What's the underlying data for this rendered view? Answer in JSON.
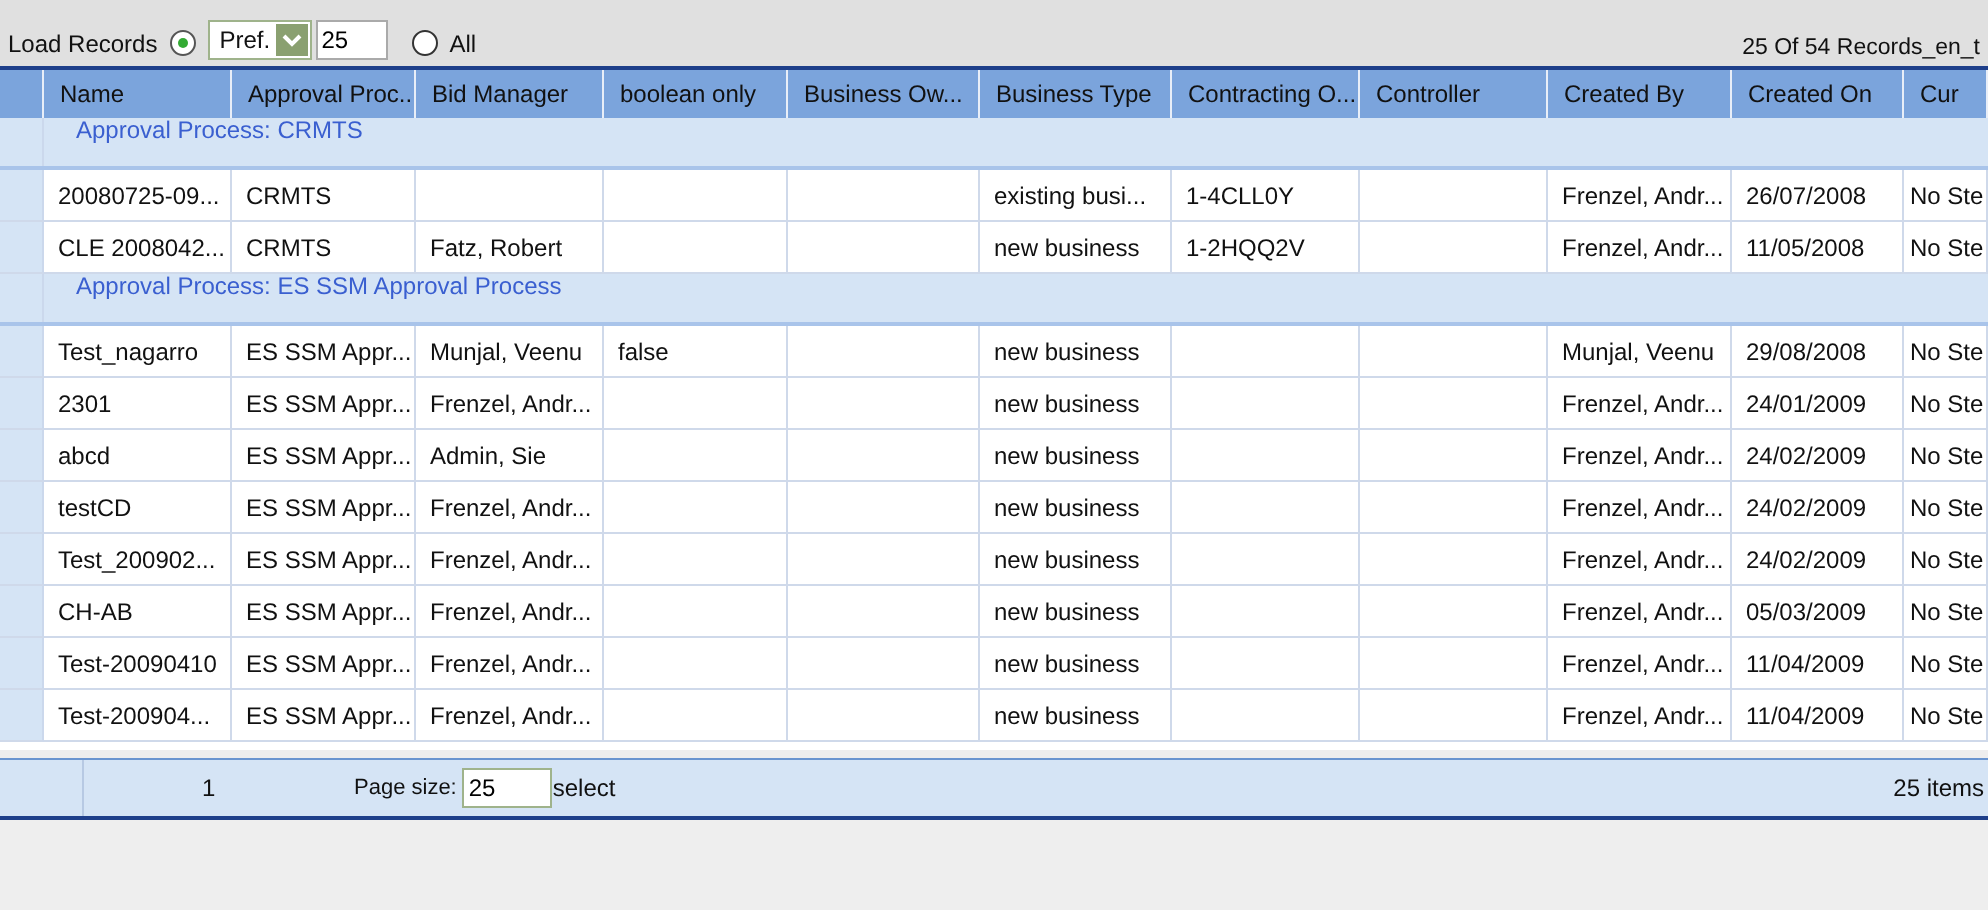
{
  "toolbar": {
    "label": "Load Records",
    "options": [
      {
        "selected": true,
        "kind": "pref"
      },
      {
        "label": "All",
        "selected": false,
        "kind": "all"
      }
    ],
    "pref_dropdown": {
      "value": "Pref."
    },
    "count_field": {
      "value": "25"
    },
    "record_count": "25 Of 54 Records_en_t"
  },
  "table": {
    "columns": [
      "Name",
      "Approval Proc...",
      "Bid Manager",
      "boolean only",
      "Business Ow...",
      "Business Type",
      "Contracting O...",
      "Controller",
      "Created By",
      "Created On",
      "Cur"
    ],
    "rows": [
      {
        "kind": "group",
        "label": "Approval Process: CRMTS"
      },
      {
        "kind": "data",
        "cells": [
          "20080725-09...",
          "CRMTS",
          "",
          "",
          "",
          "existing busi...",
          "1-4CLL0Y",
          "",
          "Frenzel, Andr...",
          "26/07/2008",
          "No Ste"
        ]
      },
      {
        "kind": "data",
        "cells": [
          "CLE 2008042...",
          "CRMTS",
          "Fatz, Robert",
          "",
          "",
          "new business",
          "1-2HQQ2V",
          "",
          "Frenzel, Andr...",
          "11/05/2008",
          "No Ste"
        ]
      },
      {
        "kind": "group",
        "label": "Approval Process: ES SSM Approval Process"
      },
      {
        "kind": "data",
        "cells": [
          "Test_nagarro",
          "ES SSM Appr...",
          "Munjal, Veenu",
          "false",
          "",
          "new business",
          "",
          "",
          "Munjal, Veenu",
          "29/08/2008",
          "No Ste"
        ]
      },
      {
        "kind": "data",
        "cells": [
          "2301",
          "ES SSM Appr...",
          "Frenzel, Andr...",
          "",
          "",
          "new business",
          "",
          "",
          "Frenzel, Andr...",
          "24/01/2009",
          "No Ste"
        ]
      },
      {
        "kind": "data",
        "cells": [
          "abcd",
          "ES SSM Appr...",
          "Admin, Sie",
          "",
          "",
          "new business",
          "",
          "",
          "Frenzel, Andr...",
          "24/02/2009",
          "No Ste"
        ]
      },
      {
        "kind": "data",
        "cells": [
          "testCD",
          "ES SSM Appr...",
          "Frenzel, Andr...",
          "",
          "",
          "new business",
          "",
          "",
          "Frenzel, Andr...",
          "24/02/2009",
          "No Ste"
        ]
      },
      {
        "kind": "data",
        "cells": [
          "Test_200902...",
          "ES SSM Appr...",
          "Frenzel, Andr...",
          "",
          "",
          "new business",
          "",
          "",
          "Frenzel, Andr...",
          "24/02/2009",
          "No Ste"
        ]
      },
      {
        "kind": "data",
        "cells": [
          "CH-AB",
          "ES SSM Appr...",
          "Frenzel, Andr...",
          "",
          "",
          "new business",
          "",
          "",
          "Frenzel, Andr...",
          "05/03/2009",
          "No Ste"
        ]
      },
      {
        "kind": "data",
        "cells": [
          "Test-20090410",
          "ES SSM Appr...",
          "Frenzel, Andr...",
          "",
          "",
          "new business",
          "",
          "",
          "Frenzel, Andr...",
          "11/04/2009",
          "No Ste"
        ]
      },
      {
        "kind": "data",
        "cells": [
          "Test-200904...",
          "ES SSM Appr...",
          "Frenzel, Andr...",
          "",
          "",
          "new business",
          "",
          "",
          "Frenzel, Andr...",
          "11/04/2009",
          "No Ste"
        ]
      }
    ]
  },
  "pager": {
    "page": "1",
    "page_size_label": "Page size:",
    "page_size": "25",
    "select": "select",
    "items": "25 items"
  }
}
